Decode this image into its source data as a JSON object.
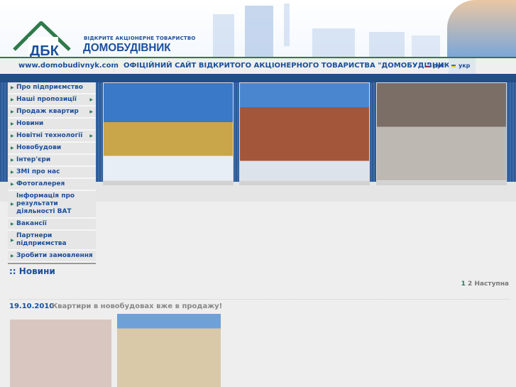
{
  "header": {
    "logo_mark": "ДБК",
    "logo_subtitle": "ВІДКРИТЕ АКЦІОНЕРНЕ ТОВАРИСТВО",
    "logo_name": "ДОМОБУДІВНИК"
  },
  "nav": {
    "url": "www.domobudivnyk.com",
    "title": "ОФІЦІЙНИЙ САЙТ ВІДКРИТОГО АКЦІОНЕРНОГО ТОВАРИСТВА \"ДОМОБУДІВНИК\"",
    "languages": [
      {
        "label": "рус",
        "active": false
      },
      {
        "label": "укр",
        "active": true
      }
    ]
  },
  "menu": [
    {
      "label": "Про підприємство",
      "submenu": false
    },
    {
      "label": "Наші пропозиції",
      "submenu": true
    },
    {
      "label": "Продаж квартир",
      "submenu": true
    },
    {
      "label": "Новини",
      "submenu": false
    },
    {
      "label": "Новітні технології",
      "submenu": true
    },
    {
      "label": "Новобудови",
      "submenu": false
    },
    {
      "label": "Інтер'єри",
      "submenu": false
    },
    {
      "label": "ЗМІ про нас",
      "submenu": false
    },
    {
      "label": "Фотогалерея",
      "submenu": false
    },
    {
      "label": "Інформація про результати діяльності ВАТ",
      "submenu": false
    },
    {
      "label": "Вакансії",
      "submenu": false
    },
    {
      "label": "Партнери підприємства",
      "submenu": false
    },
    {
      "label": "Зробити замовлення",
      "submenu": false
    }
  ],
  "section": {
    "title": ":: Новини"
  },
  "pager": {
    "current": "1",
    "page2": "2",
    "next": "Наступна"
  },
  "news": [
    {
      "date": "19.10.2010",
      "title": "Квартири в новобудовах вже в продажу!"
    }
  ]
}
